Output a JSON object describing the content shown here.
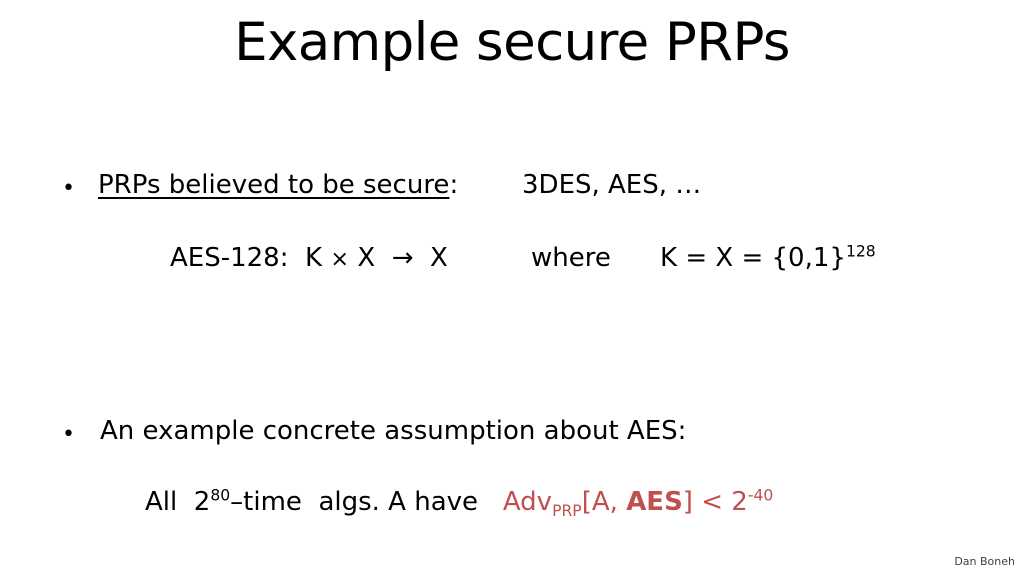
{
  "slide": {
    "title": "Example secure PRPs",
    "background_color": "#FFFFFF",
    "text_color": "#000000",
    "accent_color": "#C0504D"
  },
  "bullets": [
    {
      "marker": "•",
      "underlined_text": "PRPs believed to be secure",
      "colon": ":",
      "examples": "3DES,   AES,   …"
    },
    {
      "marker": "•",
      "text": "An example concrete assumption about AES:"
    }
  ],
  "lines": {
    "aes128": {
      "label": "AES-128:",
      "domain_key": "K",
      "times": "×",
      "domain_x": "X",
      "arrow": "→",
      "range_x": "X",
      "where": "where",
      "keyspace": "K = X = {0,1}",
      "keyspace_exponent": "128"
    },
    "assumption": {
      "prefix_all": "All",
      "time_base": "2",
      "time_exponent": "80",
      "time_suffix": "–time",
      "algs": "algs. A have",
      "adv_label": "Adv",
      "adv_subscript": "PRP",
      "bracket_open": "[A,",
      "scheme": "AES",
      "bracket_close": "]",
      "relation": "<",
      "bound_base": "2",
      "bound_exponent": "-40"
    }
  },
  "footer": {
    "author": "Dan Boneh"
  }
}
